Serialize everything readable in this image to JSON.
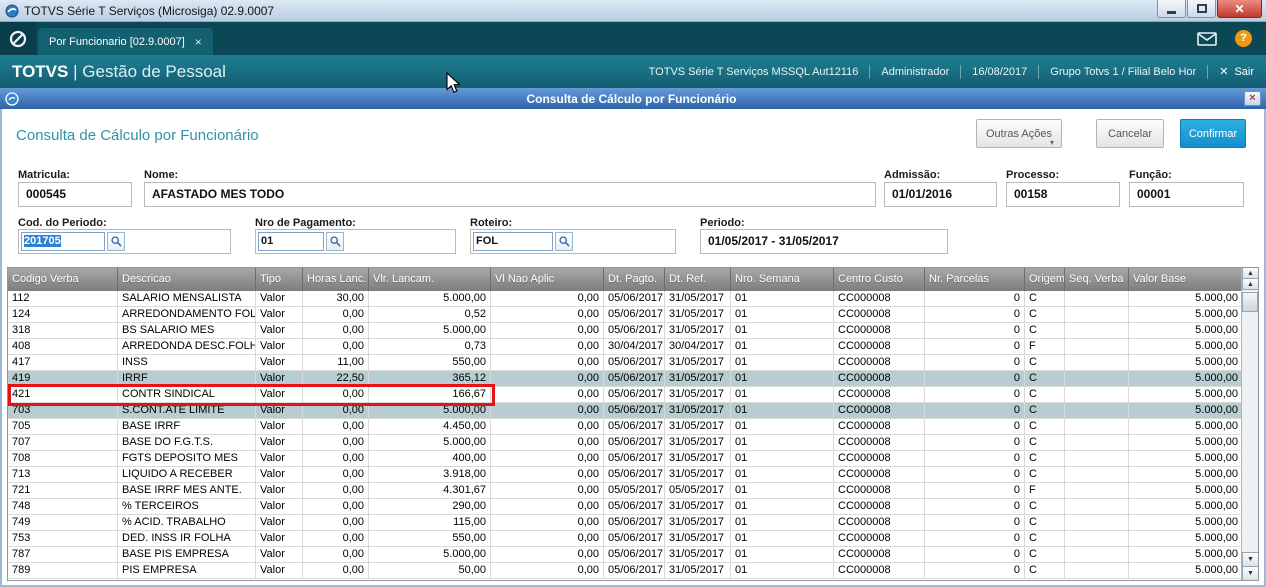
{
  "window": {
    "title": "TOTVS Série T Serviços (Microsiga) 02.9.0007"
  },
  "glyphs": {
    "close": "×",
    "x": "✕",
    "up": "▲",
    "down": "▼",
    "dropdown": "▾",
    "help": "?"
  },
  "tabbar": {
    "tab": {
      "label": "Por Funcionario [02.9.0007]"
    }
  },
  "brandbar": {
    "brand_name": "TOTVS",
    "brand_divider": "|",
    "brand_module": "Gestão de Pessoal",
    "environment": "TOTVS Série T Serviços MSSQL Aut12116",
    "user": "Administrador",
    "date": "16/08/2017",
    "company": "Grupo Totvs 1 / Filial Belo Hor",
    "exit_label": "Sair"
  },
  "dialog": {
    "titlebar": "Consulta de Cálculo por Funcionário",
    "heading": "Consulta de Cálculo por Funcionário",
    "actions": {
      "other_actions": "Outras Ações",
      "cancel": "Cancelar",
      "confirm": "Confirmar"
    },
    "form": {
      "matricula": {
        "label": "Matricula:",
        "value": "000545"
      },
      "nome": {
        "label": "Nome:",
        "value": "AFASTADO MES TODO"
      },
      "admissao": {
        "label": "Admissão:",
        "value": "01/01/2016"
      },
      "processo": {
        "label": "Processo:",
        "value": "00158"
      },
      "funcao": {
        "label": "Função:",
        "value": "00001"
      },
      "cod_periodo": {
        "label": "Cod. do Periodo:",
        "value": "201705"
      },
      "nro_pagamento": {
        "label": "Nro de Pagamento:",
        "value": "01"
      },
      "roteiro": {
        "label": "Roteiro:",
        "value": "FOL"
      },
      "periodo": {
        "label": "Periodo:",
        "value": "01/05/2017 - 31/05/2017"
      }
    }
  },
  "colors": {
    "brand_teal": "#156478",
    "confirm_blue": "#148fce",
    "annotation_red": "#e51414",
    "selected_row": "#b7cdd2",
    "text_selection_blue": "#2f80d3"
  },
  "table": {
    "columns": [
      {
        "label": "Codigo Verba",
        "width": 110,
        "align": "left"
      },
      {
        "label": "Descricao",
        "width": 138,
        "align": "left"
      },
      {
        "label": "Tipo",
        "width": 47,
        "align": "left"
      },
      {
        "label": "Horas Lanc.",
        "width": 66,
        "align": "right"
      },
      {
        "label": "Vlr. Lancam.",
        "width": 122,
        "align": "right"
      },
      {
        "label": "Vl Nao Aplic",
        "width": 113,
        "align": "right"
      },
      {
        "label": "Dt. Pagto.",
        "width": 61,
        "align": "left"
      },
      {
        "label": "Dt. Ref.",
        "width": 66,
        "align": "left"
      },
      {
        "label": "Nro. Semana",
        "width": 103,
        "align": "left"
      },
      {
        "label": "Centro Custo",
        "width": 91,
        "align": "left"
      },
      {
        "label": "Nr. Parcelas",
        "width": 100,
        "align": "right"
      },
      {
        "label": "Origem",
        "width": 40,
        "align": "left"
      },
      {
        "label": "Seq. Verba",
        "width": 64,
        "align": "left"
      },
      {
        "label": "Valor Base",
        "width": 114,
        "align": "right"
      }
    ],
    "selected_rows": [
      "419",
      "703"
    ],
    "annotated_row": "421",
    "rows": [
      [
        "112",
        "SALARIO MENSALISTA",
        "Valor",
        "30,00",
        "5.000,00",
        "0,00",
        "05/06/2017",
        "31/05/2017",
        "01",
        "CC000008",
        "0",
        "C",
        "",
        "5.000,00"
      ],
      [
        "124",
        "ARREDONDAMENTO FOLHA",
        "Valor",
        "0,00",
        "0,52",
        "0,00",
        "05/06/2017",
        "31/05/2017",
        "01",
        "CC000008",
        "0",
        "C",
        "",
        "5.000,00"
      ],
      [
        "318",
        "BS SALARIO MES",
        "Valor",
        "0,00",
        "5.000,00",
        "0,00",
        "05/06/2017",
        "31/05/2017",
        "01",
        "CC000008",
        "0",
        "C",
        "",
        "5.000,00"
      ],
      [
        "408",
        "ARREDONDA DESC.FOLH",
        "Valor",
        "0,00",
        "0,73",
        "0,00",
        "30/04/2017",
        "30/04/2017",
        "01",
        "CC000008",
        "0",
        "F",
        "",
        "5.000,00"
      ],
      [
        "417",
        "INSS",
        "Valor",
        "11,00",
        "550,00",
        "0,00",
        "05/06/2017",
        "31/05/2017",
        "01",
        "CC000008",
        "0",
        "C",
        "",
        "5.000,00"
      ],
      [
        "419",
        "IRRF",
        "Valor",
        "22,50",
        "365,12",
        "0,00",
        "05/06/2017",
        "31/05/2017",
        "01",
        "CC000008",
        "0",
        "C",
        "",
        "5.000,00"
      ],
      [
        "421",
        "CONTR SINDICAL",
        "Valor",
        "0,00",
        "166,67",
        "0,00",
        "05/06/2017",
        "31/05/2017",
        "01",
        "CC000008",
        "0",
        "C",
        "",
        "5.000,00"
      ],
      [
        "703",
        "S.CONT.ATE LIMITE",
        "Valor",
        "0,00",
        "5.000,00",
        "0,00",
        "05/06/2017",
        "31/05/2017",
        "01",
        "CC000008",
        "0",
        "C",
        "",
        "5.000,00"
      ],
      [
        "705",
        "BASE IRRF",
        "Valor",
        "0,00",
        "4.450,00",
        "0,00",
        "05/06/2017",
        "31/05/2017",
        "01",
        "CC000008",
        "0",
        "C",
        "",
        "5.000,00"
      ],
      [
        "707",
        "BASE DO F.G.T.S.",
        "Valor",
        "0,00",
        "5.000,00",
        "0,00",
        "05/06/2017",
        "31/05/2017",
        "01",
        "CC000008",
        "0",
        "C",
        "",
        "5.000,00"
      ],
      [
        "708",
        "FGTS DEPOSITO MES",
        "Valor",
        "0,00",
        "400,00",
        "0,00",
        "05/06/2017",
        "31/05/2017",
        "01",
        "CC000008",
        "0",
        "C",
        "",
        "5.000,00"
      ],
      [
        "713",
        "LIQUIDO A RECEBER",
        "Valor",
        "0,00",
        "3.918,00",
        "0,00",
        "05/06/2017",
        "31/05/2017",
        "01",
        "CC000008",
        "0",
        "C",
        "",
        "5.000,00"
      ],
      [
        "721",
        "BASE IRRF MES ANTE.",
        "Valor",
        "0,00",
        "4.301,67",
        "0,00",
        "05/05/2017",
        "05/05/2017",
        "01",
        "CC000008",
        "0",
        "F",
        "",
        "5.000,00"
      ],
      [
        "748",
        "% TERCEIROS",
        "Valor",
        "0,00",
        "290,00",
        "0,00",
        "05/06/2017",
        "31/05/2017",
        "01",
        "CC000008",
        "0",
        "C",
        "",
        "5.000,00"
      ],
      [
        "749",
        "% ACID. TRABALHO",
        "Valor",
        "0,00",
        "115,00",
        "0,00",
        "05/06/2017",
        "31/05/2017",
        "01",
        "CC000008",
        "0",
        "C",
        "",
        "5.000,00"
      ],
      [
        "753",
        "DED. INSS IR FOLHA",
        "Valor",
        "0,00",
        "550,00",
        "0,00",
        "05/06/2017",
        "31/05/2017",
        "01",
        "CC000008",
        "0",
        "C",
        "",
        "5.000,00"
      ],
      [
        "787",
        "BASE PIS EMPRESA",
        "Valor",
        "0,00",
        "5.000,00",
        "0,00",
        "05/06/2017",
        "31/05/2017",
        "01",
        "CC000008",
        "0",
        "C",
        "",
        "5.000,00"
      ],
      [
        "789",
        "PIS EMPRESA",
        "Valor",
        "0,00",
        "50,00",
        "0,00",
        "05/06/2017",
        "31/05/2017",
        "01",
        "CC000008",
        "0",
        "C",
        "",
        "5.000,00"
      ]
    ]
  }
}
